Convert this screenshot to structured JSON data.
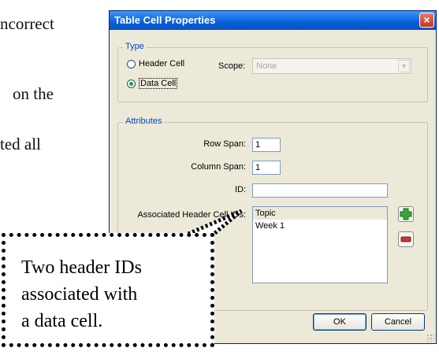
{
  "background_doc": {
    "lines": [
      "ncorrect",
      "on the",
      "ted all"
    ]
  },
  "dialog": {
    "title": "Table Cell Properties",
    "close_glyph": "×",
    "type_group": {
      "legend": "Type",
      "header_cell": "Header Cell",
      "data_cell": "Data Cell",
      "selected": "Data Cell",
      "scope_label": "Scope:",
      "scope_value": "None"
    },
    "attributes_group": {
      "legend": "Attributes",
      "row_span_label": "Row Span:",
      "row_span_value": "1",
      "column_span_label": "Column Span:",
      "column_span_value": "1",
      "id_label": "ID:",
      "id_value": "",
      "assoc_label": "Associated Header Cell IDs:",
      "assoc_items": [
        "Topic",
        "Week 1"
      ],
      "add_icon": "plus-icon",
      "remove_icon": "minus-icon"
    },
    "ok_label": "OK",
    "cancel_label": "Cancel",
    "colors": {
      "titlebar": "#0a5fd8",
      "dialog_bg": "#ece9d8",
      "legend": "#0046d5",
      "add_green": "#3aa63a",
      "remove_red": "#c8363a"
    }
  },
  "callout": {
    "text": "Two header IDs\nassociated with\na data cell."
  }
}
